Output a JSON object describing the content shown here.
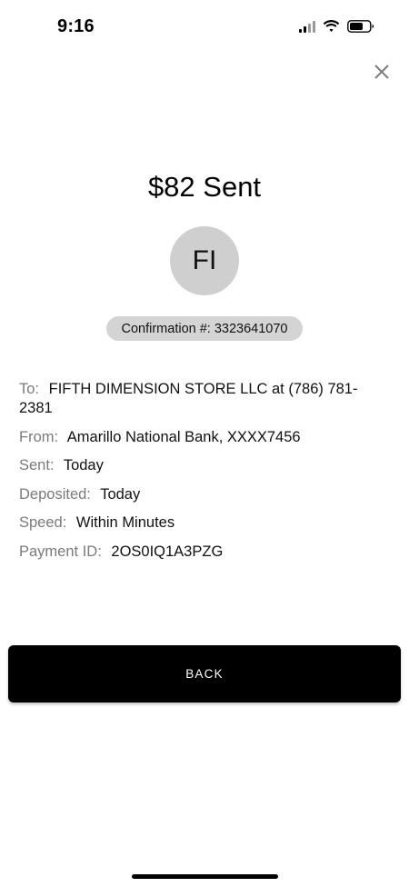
{
  "status_bar": {
    "time": "9:16",
    "icons": [
      "signal-icon",
      "wifi-icon",
      "battery-icon"
    ]
  },
  "close_icon": "close-icon",
  "title": "$82 Sent",
  "recipient": {
    "initials": "FI"
  },
  "confirmation": "Confirmation #: 3323641070",
  "details": {
    "to": {
      "label": "To:",
      "value": "FIFTH DIMENSION STORE LLC at (786) 781-2381"
    },
    "from": {
      "label": "From:",
      "value": "Amarillo National Bank, XXXX7456"
    },
    "sent": {
      "label": "Sent:",
      "value": "Today"
    },
    "deposited": {
      "label": "Deposited:",
      "value": "Today"
    },
    "speed": {
      "label": "Speed:",
      "value": "Within Minutes"
    },
    "payment_id": {
      "label": "Payment ID:",
      "value": "2OS0IQ1A3PZG"
    }
  },
  "back_button": "BACK",
  "colors": {
    "background": "#ffffff",
    "avatar": "#cfcfcf",
    "confirmation_pill": "#d4d4d4",
    "button": "#000000",
    "label_gray": "#7a7a7a"
  }
}
